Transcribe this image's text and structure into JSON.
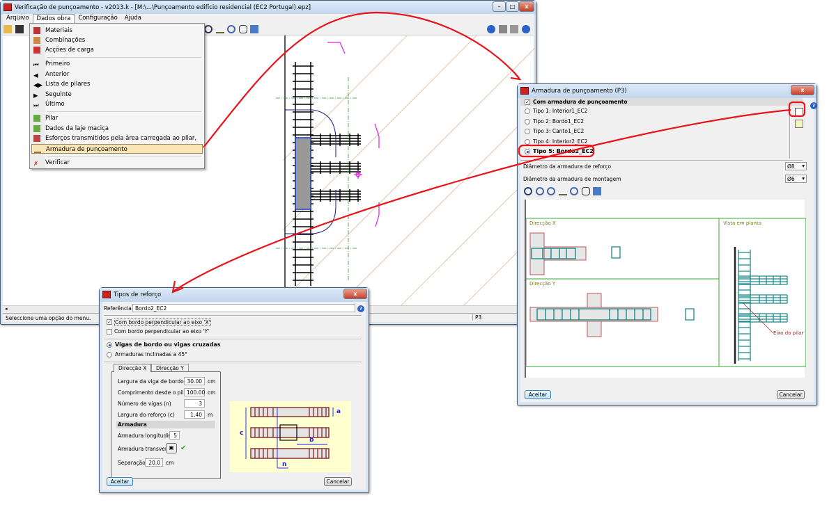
{
  "main_window": {
    "title": "Verificação de punçoamento - v2013.k - [M:\\...\\Punçoamento edifício residencial (EC2 Portugal).epz]",
    "menu": [
      "Arquivo",
      "Dados obra",
      "Configuração",
      "Ajuda"
    ],
    "status_text": "Seleccione uma opção do menu.",
    "status_pillar": "P3"
  },
  "dropdown": {
    "items": [
      {
        "label": "Materiais",
        "icon": "materials-icon"
      },
      {
        "label": "Combinações",
        "icon": "combinations-icon"
      },
      {
        "label": "Acções de carga",
        "icon": "loads-icon"
      },
      {
        "label": "Primeiro",
        "icon": "first-icon"
      },
      {
        "label": "Anterior",
        "icon": "previous-icon"
      },
      {
        "label": "Lista de pilares",
        "icon": "list-icon"
      },
      {
        "label": "Seguinte",
        "icon": "next-icon"
      },
      {
        "label": "Último",
        "icon": "last-icon"
      },
      {
        "label": "Pilar",
        "icon": "pillar-icon"
      },
      {
        "label": "Dados da laje maciça",
        "icon": "slab-icon"
      },
      {
        "label": "Esforços transmitidos pela área carregada ao pilar, por acções",
        "icon": "forces-icon"
      },
      {
        "label": "Armadura de punçoamento",
        "icon": "reinforcement-icon",
        "highlighted": true
      },
      {
        "label": "Verificar",
        "icon": "verify-icon"
      }
    ]
  },
  "armadura_dialog": {
    "title": "Armadura de punçoamento (P3)",
    "enabled_label": "Com armadura de punçoamento",
    "enabled": true,
    "types": [
      "Tipo 1: Interior1_EC2",
      "Tipo 2: Bordo1_EC2",
      "Tipo 3: Canto1_EC2",
      "Tipo 4: Interior2_EC2",
      "Tipo 5: Bordo2_EC2"
    ],
    "selected_type": 4,
    "reinf_diameter_label": "Diâmetro da armadura de reforço",
    "reinf_diameter": "Ø8",
    "mount_diameter_label": "Diâmetro da armadura de montagem",
    "mount_diameter": "Ø6",
    "panel_x": "Direcção X",
    "panel_y": "Direcção Y",
    "panel_plan": "Vista em planta",
    "pillar_axis_label": "Eixo do pilar",
    "accept": "Aceitar",
    "cancel": "Cancelar"
  },
  "tipos_dialog": {
    "title": "Tipos de reforço",
    "reference_label": "Referência",
    "reference": "Bordo2_EC2",
    "edge_x_label": "Com bordo perpendicular ao eixo 'X'",
    "edge_x": true,
    "edge_y_label": "Com bordo perpendicular ao eixo 'Y'",
    "edge_y": false,
    "opt_beams": "Vigas de bordo ou vigas cruzadas",
    "opt_inclined": "Armaduras inclinadas a 45°",
    "tabs": [
      "Direcção X",
      "Direcção Y"
    ],
    "fields": [
      {
        "label": "Largura da viga de bordo (a)",
        "value": "30.00",
        "unit": "cm"
      },
      {
        "label": "Comprimento desde o pilar (b)",
        "value": "100.00",
        "unit": "cm"
      },
      {
        "label": "Número de vigas (n)",
        "value": "3",
        "unit": ""
      },
      {
        "label": "Largura do reforço (c)",
        "value": "1.40",
        "unit": "m"
      }
    ],
    "armadura_header": "Armadura",
    "long_label": "Armadura longitudinal",
    "long_value": "5",
    "trans_label": "Armadura transversal",
    "sep_label": "Separação",
    "sep_value": "20.0",
    "sep_unit": "cm",
    "diagram_labels": {
      "a": "a",
      "b": "b",
      "c": "c",
      "n": "n"
    },
    "accept": "Aceitar",
    "cancel": "Cancelar"
  },
  "colors": {
    "annotation": "#e8141a",
    "rebar": "#1a8a8a",
    "highlight": "#fbe6b8"
  }
}
